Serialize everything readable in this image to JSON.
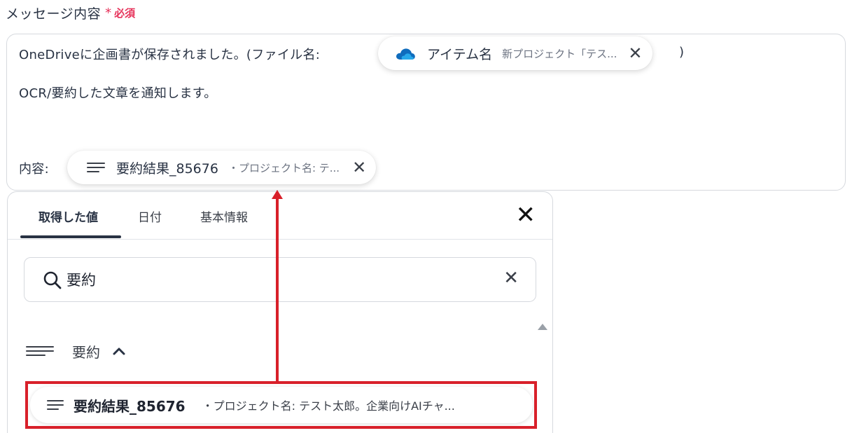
{
  "field": {
    "label": "メッセージ内容",
    "required_star": "*",
    "required_text": "必須"
  },
  "editor": {
    "line1_prefix": "OneDriveに企画書が保存されました。(ファイル名:",
    "line1_suffix": ")",
    "line2": "OCR/要約した文章を通知します。",
    "content_label": "内容:",
    "chip_item": {
      "icon": "onedrive-cloud-icon",
      "name": "アイテム名",
      "preview": "新プロジェクト「テス...",
      "close": "✕"
    },
    "chip_summary": {
      "icon": "lines-icon",
      "name": "要約結果_85676",
      "preview": "・プロジェクト名: テ...",
      "close": "✕"
    }
  },
  "panel": {
    "tabs": [
      {
        "label": "取得した値"
      },
      {
        "label": "日付"
      },
      {
        "label": "基本情報"
      }
    ],
    "close": "✕",
    "search": {
      "icon": "search-icon",
      "value": "要約",
      "clear": "✕"
    },
    "group": {
      "icon": "lines-icon",
      "name": "要約",
      "chevron": "^"
    },
    "result_item": {
      "icon": "lines-icon",
      "name": "要約結果_85676",
      "preview": "・プロジェクト名: テスト太郎。企業向けAIチャ..."
    }
  },
  "colors": {
    "accent_required": "#e6325a",
    "annotation_red": "#d8202a",
    "onedrive_blue": "#0f6cbd",
    "text_primary": "#283243"
  }
}
